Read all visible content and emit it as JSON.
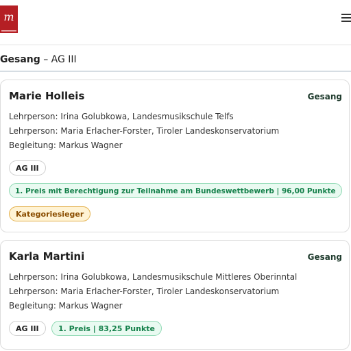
{
  "header": {
    "logo_text": "m",
    "menu_icon": "hamburger-menu-icon"
  },
  "breadcrumb": {
    "category": "Gesang",
    "separator": " – ",
    "group": "AG III"
  },
  "colors": {
    "brand_red": "#b51f24",
    "prize_green": "#14804a",
    "prize_green_bg": "#e9faf1",
    "winner_amber_bg": "#fff3d4"
  },
  "results": [
    {
      "name": "Marie Holleis",
      "category": "Gesang",
      "lines": [
        "Lehrperson: Irina Golubkowa, Landesmusikschule Telfs",
        "Lehrperson: Maria Erlacher-Forster, Tiroler Landeskonservatorium",
        "Begleitung: Markus Wagner"
      ],
      "group": "AG III",
      "prize": "1. Preis mit Berechtigung zur Teilnahme am Bundeswettbewerb | 96,00 Punkte",
      "badge": "Kategoriesieger"
    },
    {
      "name": "Karla Martini",
      "category": "Gesang",
      "lines": [
        "Lehrperson: Irina Golubkowa, Landesmusikschule Mittleres Oberinntal",
        "Lehrperson: Maria Erlacher-Forster, Tiroler Landeskonservatorium",
        "Begleitung: Markus Wagner"
      ],
      "group": "AG III",
      "prize": "1. Preis | 83,25 Punkte"
    }
  ]
}
